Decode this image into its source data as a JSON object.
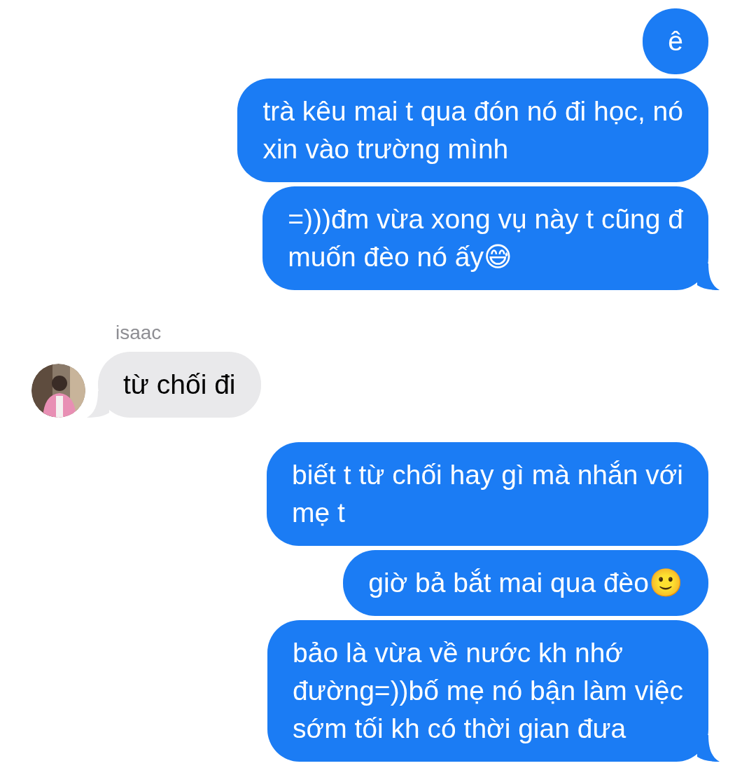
{
  "messages": [
    {
      "kind": "sent",
      "text": "ê",
      "tail": false
    },
    {
      "kind": "sent",
      "text": "trà kêu mai t qua đón nó đi học, nó\nxin vào trường mình",
      "tail": false
    },
    {
      "kind": "sent",
      "text": "=)))đm vừa xong vụ này t cũng đ\nmuốn đèo nó ấy😅",
      "tail": true
    },
    {
      "kind": "received",
      "sender": "isaac",
      "text": "từ chối đi",
      "tail": true
    },
    {
      "kind": "sent",
      "text": "biết t từ chối hay gì mà nhắn với\nmẹ t",
      "tail": false
    },
    {
      "kind": "sent",
      "text": "giờ bả bắt mai qua đèo🙂",
      "tail": false
    },
    {
      "kind": "sent",
      "text": "bảo là vừa về nước kh nhớ\nđường=))bố mẹ nó bận làm việc\nsớm tối kh có thời gian đưa",
      "tail": true
    }
  ]
}
